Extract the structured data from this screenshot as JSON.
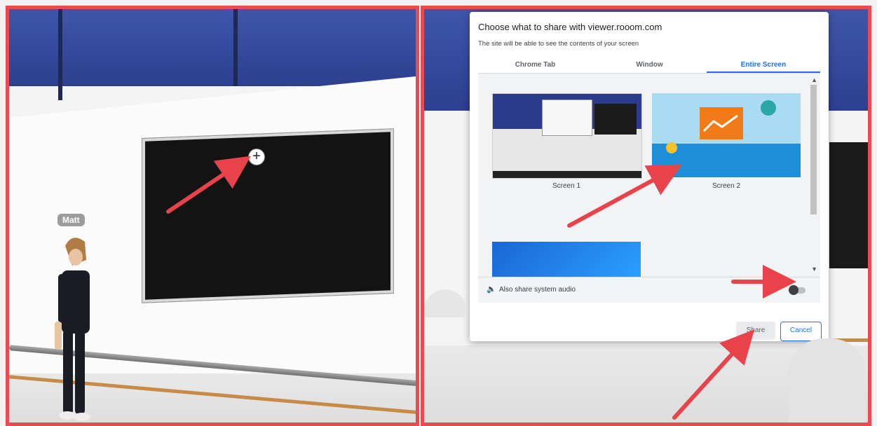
{
  "left_scene": {
    "avatar_name": "Matt",
    "add_button_glyph": "+"
  },
  "dialog": {
    "title": "Choose what to share with viewer.rooom.com",
    "subtitle": "The site will be able to see the contents of your screen",
    "tabs": [
      {
        "label": "Chrome Tab",
        "active": false
      },
      {
        "label": "Window",
        "active": false
      },
      {
        "label": "Entire Screen",
        "active": true
      }
    ],
    "screens": [
      {
        "label": "Screen 1"
      },
      {
        "label": "Screen 2"
      }
    ],
    "audio_label": "Also share system audio",
    "audio_enabled": false,
    "share_label": "Share",
    "cancel_label": "Cancel"
  },
  "colors": {
    "highlight_border": "#ea4a52",
    "accent": "#1a73e8",
    "annotation_arrow": "#e8424a"
  }
}
